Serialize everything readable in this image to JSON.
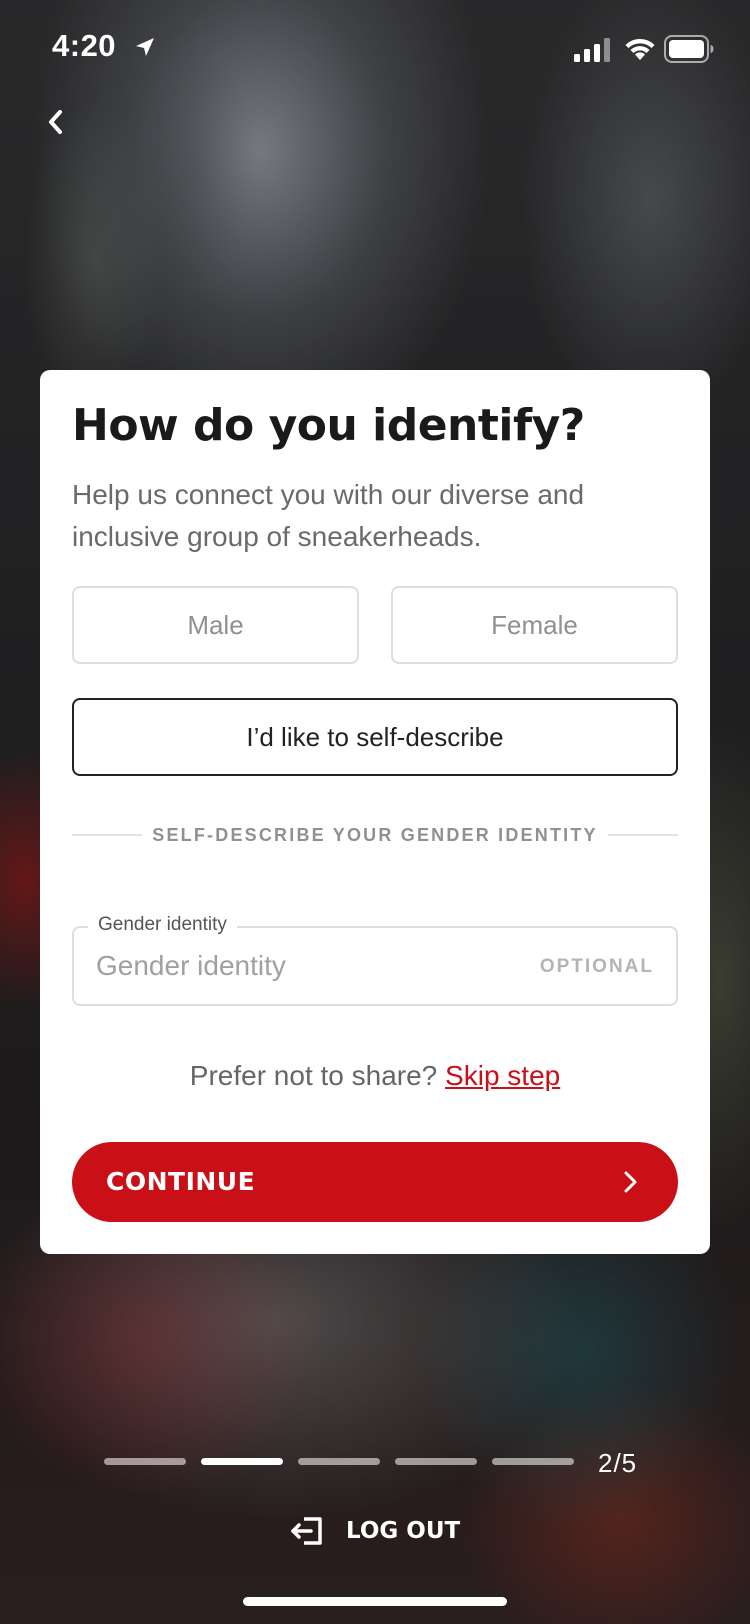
{
  "status_bar": {
    "time": "4:20",
    "icons": [
      "location-arrow-icon",
      "cellular-signal-icon",
      "wifi-icon",
      "battery-icon"
    ]
  },
  "nav": {
    "back_icon": "chevron-left-icon"
  },
  "card": {
    "title": "How do you identify?",
    "subtitle": "Help us connect you with our diverse and inclusive group of sneakerheads.",
    "options": {
      "male": "Male",
      "female": "Female",
      "self_describe": "I’d like to self-describe"
    },
    "selected_option": "self_describe",
    "divider_label": "SELF-DESCRIBE YOUR GENDER IDENTITY",
    "gender_field": {
      "label": "Gender identity",
      "placeholder": "Gender identity",
      "value": "",
      "optional_label": "OPTIONAL"
    },
    "skip_prompt": "Prefer not to share?",
    "skip_link": "Skip step",
    "continue_label": "CONTINUE",
    "continue_icon": "chevron-right-icon"
  },
  "progress": {
    "current_step": 2,
    "total_steps": 5,
    "label": "2/5"
  },
  "footer": {
    "logout_label": "LOG OUT",
    "logout_icon": "logout-icon"
  },
  "colors": {
    "accent_red": "#c81016",
    "card_background": "#ffffff",
    "title_text": "#1a1a1a",
    "muted_text": "#6a6a6a"
  }
}
